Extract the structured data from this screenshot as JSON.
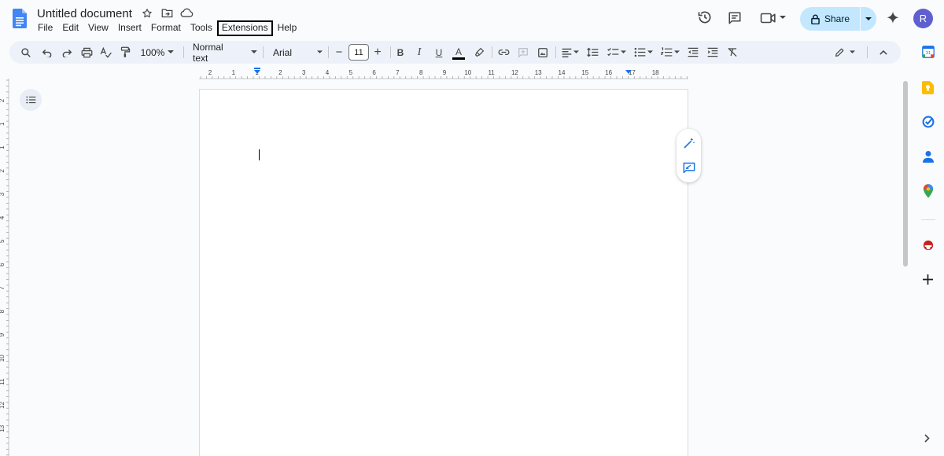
{
  "app": {
    "title": "Untitled document",
    "colors": {
      "accent": "#1a73e8",
      "share_bg": "#c2e7ff",
      "toolbar_bg": "#edf2fa",
      "avatar_bg": "#5f5fd0"
    }
  },
  "menu": {
    "items": [
      {
        "label": "File"
      },
      {
        "label": "Edit"
      },
      {
        "label": "View"
      },
      {
        "label": "Insert"
      },
      {
        "label": "Format"
      },
      {
        "label": "Tools"
      },
      {
        "label": "Extensions",
        "highlighted": true
      },
      {
        "label": "Help"
      }
    ]
  },
  "header": {
    "share_label": "Share",
    "avatar_letter": "R",
    "icons": [
      "star-icon",
      "move-folder-icon",
      "cloud-saved-icon",
      "version-history-icon",
      "comments-icon",
      "meet-video-icon",
      "lock-icon",
      "gemini-sparkle-icon"
    ]
  },
  "toolbar": {
    "zoom": "100%",
    "style": "Normal text",
    "font": "Arial",
    "font_size": "11",
    "decrease_label": "−",
    "increase_label": "+",
    "bold": "B",
    "italic": "I",
    "underline": "U",
    "text_color": "A"
  },
  "ruler": {
    "top_numbers": [
      "2",
      "1",
      "1",
      "2",
      "3",
      "4",
      "5",
      "6",
      "7",
      "8",
      "9",
      "10",
      "11",
      "12",
      "13",
      "14",
      "15",
      "16",
      "17",
      "18"
    ],
    "left_numbers": [
      "2",
      "1",
      "1",
      "2",
      "3",
      "4",
      "5",
      "6",
      "7",
      "8",
      "9",
      "10",
      "11",
      "12",
      "13"
    ]
  },
  "side_panel": {
    "icons": [
      "calendar-icon",
      "keep-icon",
      "tasks-icon",
      "contacts-icon",
      "maps-icon",
      "addon-icon",
      "add-icon",
      "expand-icon"
    ],
    "calendar_day": "31"
  }
}
